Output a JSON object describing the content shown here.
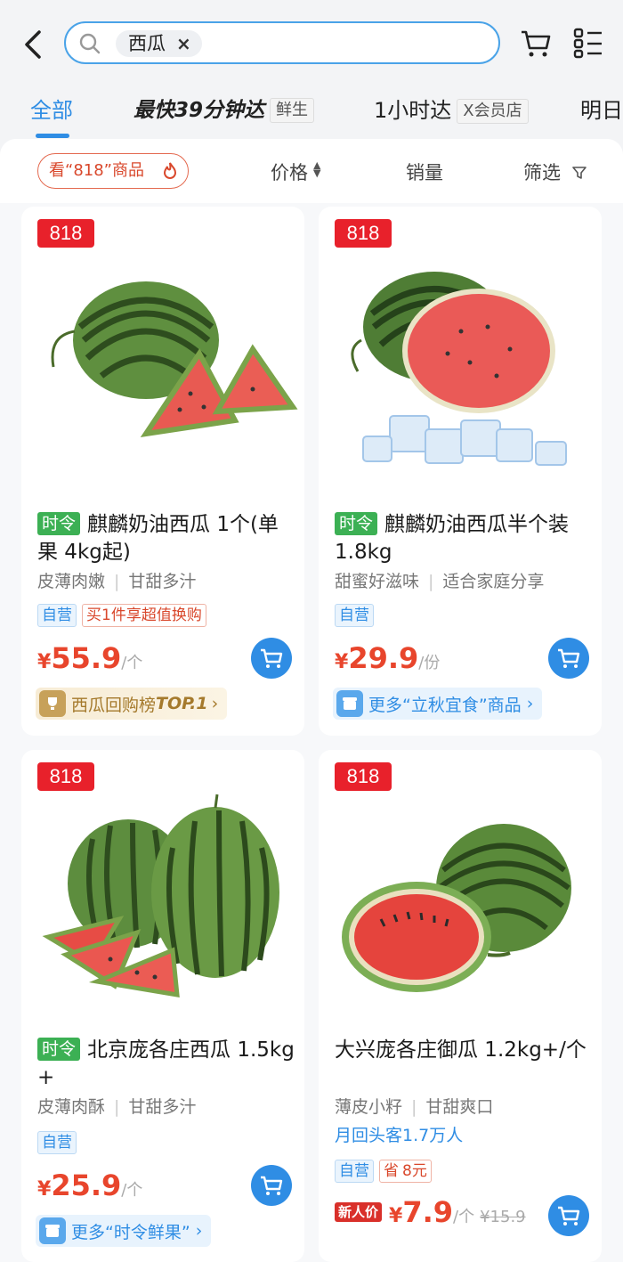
{
  "search": {
    "query": "西瓜",
    "clear": "×"
  },
  "tabs": {
    "all": "全部",
    "fastest": "最快39分钟达",
    "fastest_tag": "鲜生",
    "one_hour": "1小时达",
    "one_hour_tag": "X会员店",
    "tomorrow": "明日"
  },
  "sortbar": {
    "promo": "看“818”商品",
    "price": "价格",
    "sales": "销量",
    "filter": "筛选"
  },
  "products": [
    {
      "badge": "818",
      "time_tag": "时令",
      "title": "麒麟奶油西瓜 1个(单果 4kg起)",
      "features": [
        "皮薄肉嫩",
        "甘甜多汁"
      ],
      "tags": [
        "自营",
        "买1件享超值换购"
      ],
      "price_symbol": "¥",
      "price": "55.9",
      "unit": "/个",
      "banner": "西瓜回购榜",
      "banner_strong": "TOP.1",
      "banner_arrow": "›"
    },
    {
      "badge": "818",
      "time_tag": "时令",
      "title": "麒麟奶油西瓜半个装 1.8kg",
      "features": [
        "甜蜜好滋味",
        "适合家庭分享"
      ],
      "tags": [
        "自营"
      ],
      "price_symbol": "¥",
      "price": "29.9",
      "unit": "/份",
      "banner": "更多“立秋宜食”商品",
      "banner_arrow": "›"
    },
    {
      "badge": "818",
      "time_tag": "时令",
      "title": "北京庞各庄西瓜 1.5kg +",
      "features": [
        "皮薄肉酥",
        "甘甜多汁"
      ],
      "tags": [
        "自营"
      ],
      "price_symbol": "¥",
      "price": "25.9",
      "unit": "/个",
      "banner": "更多“时令鲜果”",
      "banner_arrow": "›"
    },
    {
      "badge": "818",
      "title": "大兴庞各庄御瓜 1.2kg+/个",
      "features": [
        "薄皮小籽",
        "甘甜爽口"
      ],
      "rebuy": "月回头客1.7万人",
      "tags": [
        "自营"
      ],
      "save_label": "省",
      "save_value": "8元",
      "new_price_label": "新人价",
      "price_symbol": "¥",
      "price": "7.9",
      "unit": "/个",
      "original_price": "¥15.9"
    }
  ],
  "colors": {
    "accent": "#2f8de4",
    "price": "#e8452c",
    "badge": "#e8212b",
    "season": "#3cb054"
  }
}
